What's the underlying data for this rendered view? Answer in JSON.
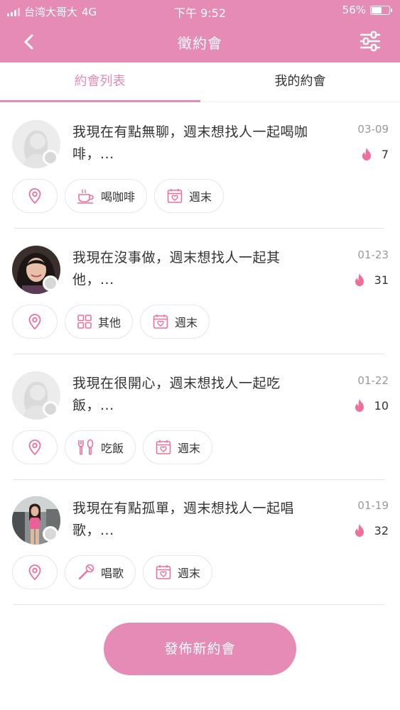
{
  "status_bar": {
    "carrier": "台湾大哥大",
    "network": "4G",
    "time": "下午 9:52",
    "battery": "56%"
  },
  "header": {
    "title": "徵約會"
  },
  "tabs": [
    {
      "label": "約會列表",
      "active": true
    },
    {
      "label": "我的約會",
      "active": false
    }
  ],
  "posts": [
    {
      "message": "我現在有點無聊，週末想找人一起喝咖啡，...",
      "date": "03-09",
      "count": "7",
      "activity": "喝咖啡",
      "activity_icon": "coffee-icon",
      "time_label": "週末",
      "avatar": "placeholder"
    },
    {
      "message": "我現在沒事做，週末想找人一起其他，...",
      "date": "01-23",
      "count": "31",
      "activity": "其他",
      "activity_icon": "grid-icon",
      "time_label": "週末",
      "avatar": "photo"
    },
    {
      "message": "我現在很開心，週末想找人一起吃飯，...",
      "date": "01-22",
      "count": "10",
      "activity": "吃飯",
      "activity_icon": "utensils-icon",
      "time_label": "週末",
      "avatar": "placeholder"
    },
    {
      "message": "我現在有點孤單，週末想找人一起唱歌，...",
      "date": "01-19",
      "count": "32",
      "activity": "唱歌",
      "activity_icon": "microphone-icon",
      "time_label": "週末",
      "avatar": "photo"
    }
  ],
  "publish_button": {
    "label": "發佈新約會"
  },
  "colors": {
    "accent": "#e58bb6",
    "icon": "#ef6f9c",
    "divider": "#e3e3e3"
  }
}
